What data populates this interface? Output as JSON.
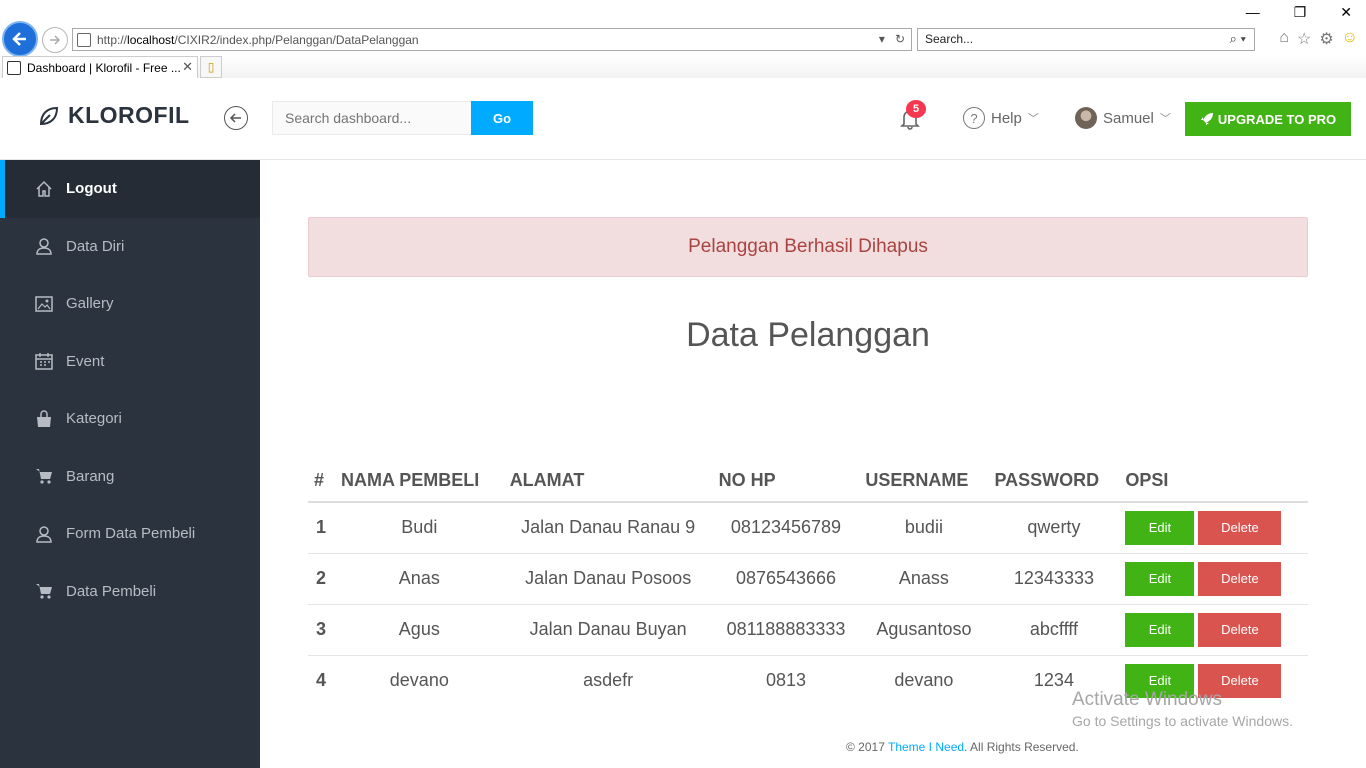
{
  "browser": {
    "url_prefix": "http://",
    "url_host": "localhost",
    "url_path": "/CIXIR2/index.php/Pelanggan/DataPelanggan",
    "search_placeholder": "Search...",
    "tab_title": "Dashboard | Klorofil - Free ...",
    "window_controls": [
      "—",
      "❐",
      "✕"
    ]
  },
  "header": {
    "brand": "KLOROFIL",
    "search_placeholder": "Search dashboard...",
    "go_label": "Go",
    "notification_count": "5",
    "help_label": "Help",
    "user_name": "Samuel",
    "upgrade_label": "UPGRADE TO PRO",
    "accent_color": "#00aaff",
    "success_color": "#41b314"
  },
  "sidebar": {
    "items": [
      {
        "label": "Logout",
        "icon": "home-icon",
        "active": true
      },
      {
        "label": "Data Diri",
        "icon": "user-icon"
      },
      {
        "label": "Gallery",
        "icon": "image-icon"
      },
      {
        "label": "Event",
        "icon": "calendar-icon"
      },
      {
        "label": "Kategori",
        "icon": "bag-icon"
      },
      {
        "label": "Barang",
        "icon": "cart-icon"
      },
      {
        "label": "Form Data Pembeli",
        "icon": "user-icon"
      },
      {
        "label": "Data Pembeli",
        "icon": "cart-icon"
      }
    ]
  },
  "main": {
    "alert": "Pelanggan Berhasil Dihapus",
    "title": "Data Pelanggan",
    "table": {
      "headers": [
        "#",
        "NAMA PEMBELI",
        "ALAMAT",
        "NO HP",
        "USERNAME",
        "PASSWORD",
        "OPSI"
      ],
      "rows": [
        [
          "1",
          "Budi",
          "Jalan Danau Ranau 9",
          "08123456789",
          "budii",
          "qwerty"
        ],
        [
          "2",
          "Anas",
          "Jalan Danau Posoos",
          "0876543666",
          "Anass",
          "12343333"
        ],
        [
          "3",
          "Agus",
          "Jalan Danau Buyan",
          "081188883333",
          "Agusantoso",
          "abcffff"
        ],
        [
          "4",
          "devano",
          "asdefr",
          "0813",
          "devano",
          "1234"
        ]
      ],
      "edit_label": "Edit",
      "delete_label": "Delete"
    },
    "footer_prefix": "© 2017 ",
    "footer_link": "Theme I Need",
    "footer_suffix": ". All Rights Reserved."
  },
  "watermark": {
    "title": "Activate Windows",
    "subtitle": "Go to Settings to activate Windows."
  }
}
